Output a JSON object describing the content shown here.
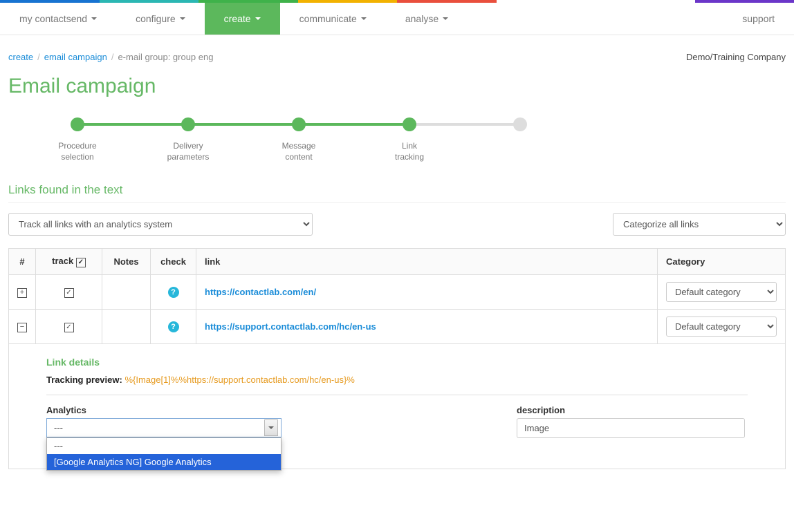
{
  "topstrip_colors": [
    "#1773d1",
    "#2bb7b3",
    "#3fb24a",
    "#f2b200",
    "#e94f3d",
    "#ffffff",
    "#ffffff",
    "#6b36c9"
  ],
  "nav": {
    "items": [
      {
        "label": "my contactsend",
        "active": false
      },
      {
        "label": "configure",
        "active": false
      },
      {
        "label": "create",
        "active": true
      },
      {
        "label": "communicate",
        "active": false
      },
      {
        "label": "analyse",
        "active": false
      }
    ],
    "support": "support"
  },
  "breadcrumb": {
    "items": [
      {
        "label": "create",
        "link": true
      },
      {
        "label": "email campaign",
        "link": true
      },
      {
        "label": "e-mail group: group eng",
        "link": false
      }
    ]
  },
  "company": "Demo/Training Company",
  "page_title": "Email campaign",
  "steps": [
    {
      "label": "Procedure selection",
      "done": true
    },
    {
      "label": "Delivery parameters",
      "done": true
    },
    {
      "label": "Message content",
      "done": true
    },
    {
      "label": "Link tracking",
      "done": true
    },
    {
      "label": "",
      "done": false
    }
  ],
  "section_title": "Links found in the text",
  "track_select": "Track all links with an analytics system",
  "categorize_select": "Categorize all links",
  "table": {
    "headers": {
      "num": "#",
      "track": "track",
      "notes": "Notes",
      "check": "check",
      "link": "link",
      "category": "Category"
    },
    "rows": [
      {
        "expanded": false,
        "tracked": true,
        "url": "https://contactlab.com/en/",
        "category": "Default category"
      },
      {
        "expanded": true,
        "tracked": true,
        "url": "https://support.contactlab.com/hc/en-us",
        "category": "Default category"
      }
    ]
  },
  "details": {
    "title": "Link details",
    "preview_label": "Tracking preview:",
    "preview_value": "%{Image[1]%%https://support.contactlab.com/hc/en-us}%",
    "analytics_label": "Analytics",
    "analytics_value": "---",
    "analytics_options": [
      "---",
      "[Google Analytics NG] Google Analytics"
    ],
    "description_label": "description",
    "description_value": "Image"
  }
}
